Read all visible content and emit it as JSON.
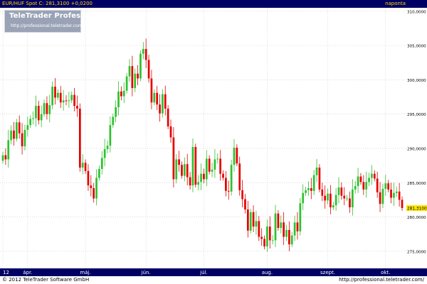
{
  "header": {
    "symbol_label": "EUR/HUF Spot C: 281,3100 +0,0200",
    "period_label": "naponta"
  },
  "logo": {
    "brand": "TeleTrader Professional",
    "url": "http://professional.teletrader.com/"
  },
  "footer": {
    "copyright": "© 2012 TeleTrader Software GmbH",
    "url": "http://professional.teletrader.com/"
  },
  "colors": {
    "up": "#2ec12e",
    "down": "#e60000",
    "price_tag": "#ffe600",
    "bar": "#000064",
    "grid": "#c8c8c8"
  },
  "chart_data": {
    "type": "candlestick",
    "title": "EUR/HUF Spot",
    "last_price_label": "281,3100",
    "ylim": [
      272.5,
      310.5
    ],
    "y_ticks": [
      {
        "value": 275,
        "label": "275,0000"
      },
      {
        "value": 280,
        "label": "280,0000"
      },
      {
        "value": 285,
        "label": "285,0000"
      },
      {
        "value": 290,
        "label": "290,0000"
      },
      {
        "value": 295,
        "label": "295,0000"
      },
      {
        "value": 300,
        "label": "300,0000"
      },
      {
        "value": 305,
        "label": "305,0000"
      },
      {
        "value": 310,
        "label": "310,0000"
      }
    ],
    "x_ticks": [
      {
        "index": 0,
        "label": "12"
      },
      {
        "index": 9,
        "label": "ápr."
      },
      {
        "index": 30,
        "label": "máj."
      },
      {
        "index": 52,
        "label": "jún."
      },
      {
        "index": 73,
        "label": "júl."
      },
      {
        "index": 96,
        "label": "aug."
      },
      {
        "index": 118,
        "label": "szept."
      },
      {
        "index": 139,
        "label": "okt."
      }
    ],
    "grid": true,
    "ohlc_close": [
      289.0,
      288.4,
      291.2,
      292.6,
      291.4,
      293.8,
      292.2,
      290.3,
      292.7,
      293.4,
      294.3,
      294.4,
      296.2,
      294.1,
      295.0,
      296.6,
      295.0,
      296.3,
      299.0,
      297.4,
      298.1,
      296.7,
      297.0,
      296.9,
      297.0,
      297.8,
      296.2,
      295.8,
      287.2,
      287.9,
      286.7,
      284.6,
      284.2,
      282.7,
      285.7,
      287.0,
      288.6,
      289.9,
      290.4,
      293.4,
      294.6,
      296.0,
      298.3,
      297.6,
      298.4,
      300.5,
      302.0,
      298.8,
      300.9,
      300.2,
      303.8,
      304.5,
      302.9,
      300.2,
      296.7,
      298.1,
      296.4,
      295.1,
      297.9,
      295.8,
      293.2,
      291.6,
      285.5,
      288.4,
      287.6,
      286.0,
      287.7,
      285.8,
      284.6,
      290.2,
      284.7,
      285.1,
      286.3,
      285.5,
      288.5,
      286.6,
      286.9,
      288.4,
      288.5,
      286.3,
      285.7,
      283.8,
      283.7,
      287.6,
      290.1,
      287.8,
      283.9,
      282.6,
      281.1,
      278.0,
      280.7,
      278.6,
      279.4,
      277.1,
      276.8,
      275.7,
      278.6,
      276.6,
      276.6,
      280.5,
      278.4,
      279.2,
      277.1,
      278.1,
      276.0,
      277.3,
      279.2,
      277.9,
      282.0,
      283.5,
      283.9,
      284.2,
      283.8,
      286.1,
      287.2,
      284.0,
      283.1,
      282.4,
      283.4,
      281.4,
      281.7,
      283.2,
      284.3,
      283.1,
      282.7,
      282.7,
      281.4,
      284.0,
      284.5,
      285.9,
      285.1,
      284.0,
      285.1,
      285.7,
      286.3,
      285.6,
      283.6,
      281.9,
      284.1,
      284.9,
      284.0,
      282.8,
      283.5,
      283.7,
      282.5,
      281.3
    ],
    "close_series_name": "EUR/HUF Spot"
  }
}
